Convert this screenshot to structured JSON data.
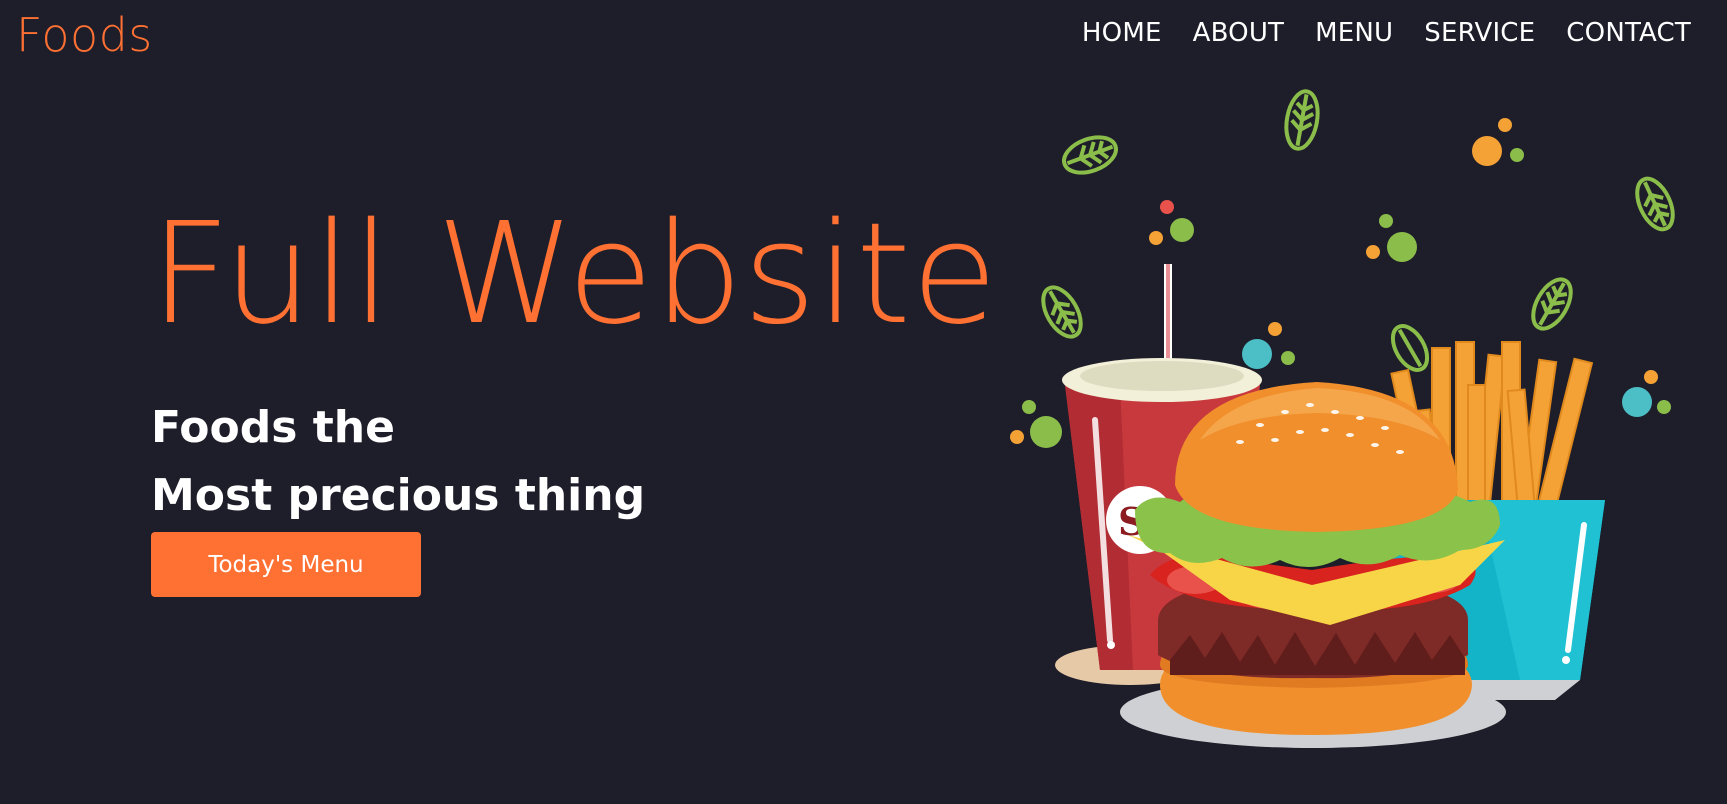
{
  "brand": {
    "logo": "Foods"
  },
  "nav": {
    "items": [
      {
        "label": "HOME"
      },
      {
        "label": "ABOUT"
      },
      {
        "label": "MENU"
      },
      {
        "label": "SERVICE"
      },
      {
        "label": "CONTACT"
      }
    ]
  },
  "hero": {
    "title": "Full Website",
    "tagline_line1": "Foods the",
    "tagline_line2": "Most precious thing",
    "cta_label": "Today's Menu"
  },
  "illustration": {
    "items": [
      "burger",
      "soda-cup",
      "french-fries",
      "leaves",
      "dots"
    ]
  },
  "colors": {
    "background": "#1e1d2a",
    "accent": "#fe7133",
    "text": "#ffffff"
  }
}
